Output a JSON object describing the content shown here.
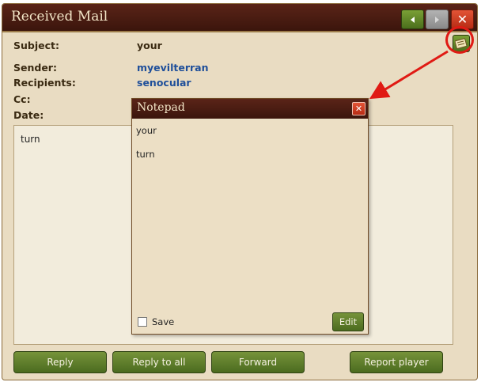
{
  "window": {
    "title": "Received Mail",
    "prev_icon": "arrow-left-icon",
    "next_icon": "arrow-right-icon",
    "close_icon": "close-icon"
  },
  "mail": {
    "subject_label": "Subject:",
    "subject_value": "your",
    "sender_label": "Sender:",
    "sender_value": "myevilterran",
    "recipients_label": "Recipients:",
    "recipients_value": "senocular",
    "cc_label": "Cc:",
    "date_label": "Date:",
    "body": "turn",
    "notepad_icon": "notepad-icon"
  },
  "buttons": {
    "reply": "Reply",
    "reply_all": "Reply to all",
    "forward": "Forward",
    "report": "Report player"
  },
  "notepad": {
    "title": "Notepad",
    "lines": [
      "your",
      "turn"
    ],
    "save_label": "Save",
    "save_checked": false,
    "edit_label": "Edit"
  },
  "colors": {
    "titlebar": "#4a1d12",
    "panel": "#e9dcc2",
    "button_green": "#5f7f2a",
    "link_blue": "#1f4f9a",
    "callout_red": "#e01a14"
  }
}
